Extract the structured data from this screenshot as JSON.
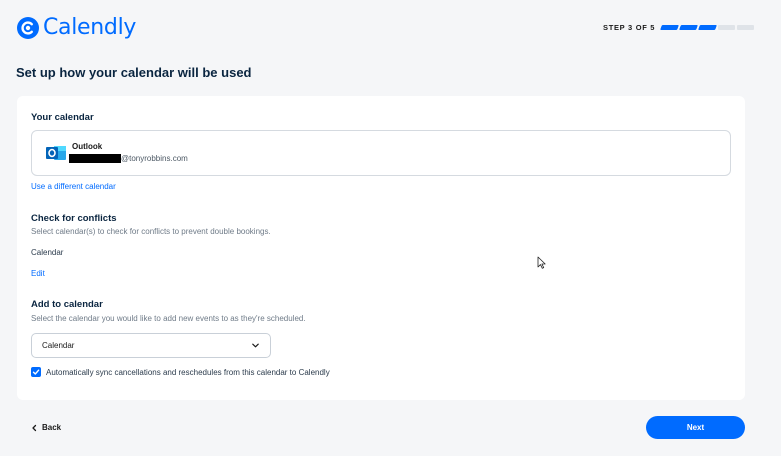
{
  "header": {
    "logo_text": "Calendly",
    "step_label": "STEP 3 OF 5",
    "steps_total": 5,
    "steps_completed": 3
  },
  "page": {
    "title": "Set up how your calendar will be used"
  },
  "your_calendar": {
    "heading": "Your calendar",
    "provider": "Outlook",
    "email_suffix": "@tonyrobbins.com",
    "change_link": "Use a different calendar"
  },
  "conflicts": {
    "heading": "Check for conflicts",
    "description": "Select calendar(s) to check for conflicts to prevent double bookings.",
    "calendar_name": "Calendar",
    "edit_link": "Edit"
  },
  "add_to_calendar": {
    "heading": "Add to calendar",
    "description": "Select the calendar you would like to add new events to as they're scheduled.",
    "selected": "Calendar",
    "sync_checked": true,
    "sync_label": "Automatically sync cancellations and reschedules from this calendar to Calendly"
  },
  "footer": {
    "back_label": "Back",
    "next_label": "Next"
  },
  "colors": {
    "brand": "#006bff",
    "text": "#0a2540",
    "background": "#f5f6f8"
  }
}
